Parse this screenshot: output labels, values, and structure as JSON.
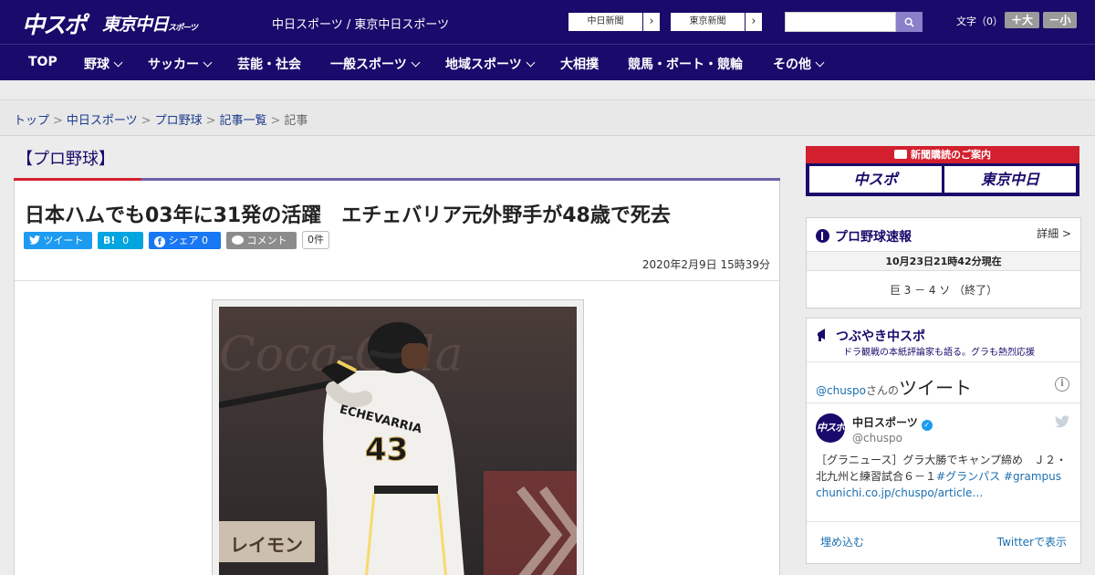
{
  "header": {
    "logo_chuspo": "中スポ",
    "logo_tokyo": "東京中日",
    "logo_tokyo_suffix": "スポーツ",
    "site_name": "中日スポーツ / 東京中日スポーツ",
    "paper_links": [
      "中日新聞",
      "東京新聞"
    ],
    "font_label": "文字（0）",
    "font_up": "＋大",
    "font_down": "－小"
  },
  "nav": {
    "items": [
      {
        "label": "TOP",
        "dropdown": false
      },
      {
        "label": "野球",
        "dropdown": true
      },
      {
        "label": "サッカー",
        "dropdown": true
      },
      {
        "label": "芸能・社会",
        "dropdown": false
      },
      {
        "label": "一般スポーツ",
        "dropdown": true
      },
      {
        "label": "地域スポーツ",
        "dropdown": true
      },
      {
        "label": "大相撲",
        "dropdown": false
      },
      {
        "label": "競馬・ボート・競輪",
        "dropdown": false
      },
      {
        "label": "その他",
        "dropdown": true
      }
    ]
  },
  "breadcrumb": {
    "items": [
      "トップ",
      "中日スポーツ",
      "プロ野球",
      "記事一覧"
    ],
    "current": "記事",
    "separator": ">"
  },
  "article": {
    "category": "【プロ野球】",
    "headline": "日本ハムでも03年に31発の活躍　エチェバリア元外野手が48歳で死去",
    "share": {
      "tweet": "ツイート",
      "hatena": "B!",
      "hatena_count": "0",
      "facebook": "シェア",
      "facebook_count": "0",
      "comment": "コメント",
      "comment_count": "0件"
    },
    "date": "2020年2月9日 15時39分",
    "photo": {
      "jersey_name": "ECHEVARRIA",
      "jersey_number": "43",
      "bg_sign": "レイモン",
      "bg_logo": "Coca-Cola"
    }
  },
  "sidebar": {
    "subscription": {
      "title": "新聞購読のご案内",
      "buttons": [
        "中スポ",
        "東京中日"
      ]
    },
    "score": {
      "title": "プロ野球速報",
      "detail": "詳細 >",
      "date": "10月23日21時42分現在",
      "game": "巨 3 － 4 ソ （終了）"
    },
    "twitter": {
      "title": "つぶやき中スポ",
      "subtitle": "ドラ観戦の本紙評論家も語る。グラも熱烈応援",
      "handle": "@chuspo",
      "handle_suffix": "さんの",
      "tweets_label": "ツイート",
      "user_name": "中日スポーツ",
      "user_handle": "@chuspo",
      "avatar_text": "中スポ",
      "tweet_text": "［グラニュース］グラ大勝でキャンプ締め　Ｊ２・北九州と練習試合６－１",
      "tweet_tags": "#グランパス #grampus",
      "tweet_link": "chunichi.co.jp/chuspo/article…",
      "embed": "埋め込む",
      "view_on": "Twitterで表示"
    }
  },
  "colors": {
    "brand": "#1a0a6b",
    "accent_red": "#d3202e",
    "twitter_blue": "#1d9bf0",
    "facebook": "#1877f2",
    "hatena": "#00a4de"
  }
}
